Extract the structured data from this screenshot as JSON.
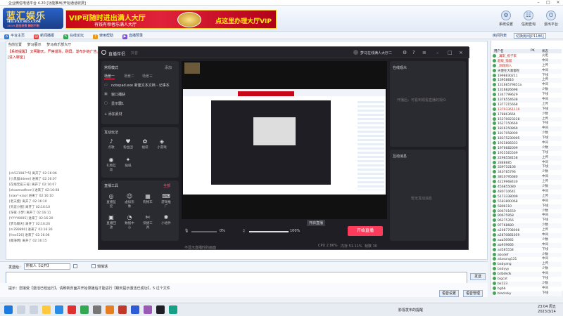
{
  "window": {
    "title": "企业微信电话平台 4.20 [功能推出/开始通话收费]"
  },
  "header": {
    "logo_main": "蓝汇娱乐",
    "logo_url": "HD.FXT365.COM",
    "logo_sub": "2019 超低资费 精彩不断",
    "banner_left": "VIP可随时进出满人大厅",
    "banner_left_sub": "有钱有帝者乐满人大厅",
    "banner_right": "点这里办理大厅VIP",
    "buttons": [
      {
        "label": "系统设置",
        "icon": "gear-icon"
      },
      {
        "label": "信用查询",
        "icon": "id-icon"
      },
      {
        "label": "退出平台",
        "icon": "exit-icon"
      }
    ]
  },
  "toolbar": {
    "items": [
      "平台主页",
      "新闻播报",
      "在线论坛",
      "使用帮助",
      "直播预录"
    ],
    "right_tabs": [
      "房间列表",
      "切换房间[P1186]"
    ]
  },
  "chat": {
    "tabs": [
      "当前位置",
      "梦马展示",
      "梦马商乐部大厅"
    ],
    "announcement": "【系统提醒】 文明聊天，严禁谩骂，刷屏，发布外链广告。违者永久封禁 ...",
    "welcome": "[进入聊室]",
    "log": [
      "[ch521987*5] 离开了 02:16:06",
      "[小黑猫ddeee] 进来了 02:16:07",
      "[在线无名三号] 离开了 02:16:07",
      "[zhaomadfrom] 进来了 02:16:08",
      "[xiao*-xiao] 进来了 02:16:10",
      "[老天使] 离开了 02:16:10",
      "[天涯小猪] 离开了 02:16:10",
      "[深夜 小梦] 离开了 02:16:11",
      "[YYYY0005] 进来了 02:16:20",
      "[梦马聊天] 离开了 02:16:26",
      "[m789890] 进来了 02:16:36",
      "[free526] 进来了 02:16:06",
      "[卿海明] 离开了 02:16:15"
    ]
  },
  "userlist": {
    "columns": [
      "用户名",
      "PK",
      "状态"
    ],
    "users": [
      {
        "name": "_翼影_橙子家",
        "status": "火炬"
      },
      {
        "name": "超级_猫猫",
        "status": "中间"
      },
      {
        "name": "_翔翔翔人",
        "status": "上传"
      },
      {
        "name": "天使在大家都在",
        "status": "中间"
      },
      {
        "name": "1998830211",
        "status": "下线"
      },
      {
        "name": "13958816",
        "status": "上传"
      },
      {
        "name": "13168579851a",
        "status": "中间"
      },
      {
        "name": "1316826698",
        "status": "少数"
      },
      {
        "name": "1347799629",
        "status": "下线"
      },
      {
        "name": "1376554638",
        "status": "中间"
      },
      {
        "name": "1377215668",
        "status": "上传"
      },
      {
        "name": "13793361119",
        "status": "下线"
      },
      {
        "name": "178863664",
        "status": "少数"
      },
      {
        "name": "15270023228",
        "status": "上传"
      },
      {
        "name": "1627150669",
        "status": "下线"
      },
      {
        "name": "1816150869",
        "status": "中间"
      },
      {
        "name": "1817058009",
        "status": "少数"
      },
      {
        "name": "18375230005",
        "status": "下线"
      },
      {
        "name": "1925808333",
        "status": "中间"
      },
      {
        "name": "1976682009",
        "status": "少数"
      },
      {
        "name": "1955565569",
        "status": "下线"
      },
      {
        "name": "2298558158",
        "status": "上传"
      },
      {
        "name": "2888885",
        "status": "中间"
      },
      {
        "name": "339710106",
        "status": "下线"
      },
      {
        "name": "340785796",
        "status": "少数"
      },
      {
        "name": "3810795680",
        "status": "中间"
      },
      {
        "name": "4229968430",
        "status": "上传"
      },
      {
        "name": "456855080",
        "status": "少数"
      },
      {
        "name": "480710641",
        "status": "中间"
      },
      {
        "name": "5173338009",
        "status": "上传"
      },
      {
        "name": "5583800068",
        "status": "中间"
      },
      {
        "name": "5806110",
        "status": "下线"
      },
      {
        "name": "806701659",
        "status": "少数"
      },
      {
        "name": "90675958",
        "status": "中间"
      },
      {
        "name": "96275356",
        "status": "下线"
      },
      {
        "name": "97768680",
        "status": "少数"
      },
      {
        "name": "a2087708008",
        "status": "上传"
      },
      {
        "name": "a2870881059",
        "status": "中间"
      },
      {
        "name": "aab56985",
        "status": "少数"
      },
      {
        "name": "ab939666",
        "status": "中间"
      },
      {
        "name": "ad585558",
        "status": "下线"
      },
      {
        "name": "abcdef",
        "status": "少数"
      },
      {
        "name": "aliasong131",
        "status": "中间"
      },
      {
        "name": "babyang",
        "status": "上传"
      },
      {
        "name": "babyyy",
        "status": "少数"
      },
      {
        "name": "bdbdkdk",
        "status": "中间"
      },
      {
        "name": "bigcat",
        "status": "下线"
      },
      {
        "name": "bk123",
        "status": "少数"
      },
      {
        "name": "bgbb",
        "status": "中间"
      },
      {
        "name": "blacksky",
        "status": "下线"
      }
    ]
  },
  "input": {
    "label": "发送给：",
    "select_value": "所有人【公开】",
    "checkbox_label": "悄悄话",
    "send_label": "发送",
    "tips": "提示：您接受【激活已经运行】，请刷新页面并开始录播后才能进行【聊天提示激活已成功】，5 过个文件",
    "btn_settings": "语音设置",
    "btn_manage": "语音管理"
  },
  "obs": {
    "app_name": "直播伴侣",
    "version": "抖音",
    "profile": "梦马在线满人大厅二",
    "scene_section": "常规模式",
    "scene_add": "添加",
    "scene_tabs": [
      "场景一",
      "场景二",
      "场景三"
    ],
    "sources": [
      "notepad.exe 新建文本文档 - 记事本",
      "窗口捕获",
      "显示器1"
    ],
    "add_source": "添加素材",
    "interact_title": "互动玩法",
    "interact_items": [
      "点歌",
      "粉丝团",
      "福袋",
      "小游戏",
      "礼物互动",
      "贴纸"
    ],
    "tools_title": "直播工具",
    "tools_link": "全部",
    "tools_items": [
      "直播监控",
      "虚拟形象",
      "购物车",
      "游戏推广",
      "直播回放",
      "数据中心",
      "快捷工具",
      "小组件"
    ],
    "room_title": "在线观众",
    "room_empty": "开播后，可看到观看直播的观众",
    "interact_msg_title": "互动消息",
    "interact_msg_empty": "暂无互动消息",
    "mic_pct": "0%",
    "speaker_pct": "100%",
    "go_live": "开始直播",
    "cpu": "CPU 2.86%",
    "mem": "内存 51.11%",
    "fps": "帧数 30",
    "screen_tip": "不显示直播时的画面",
    "tooltip": "开启直播"
  },
  "taskbar": {
    "running_label": "影视发布的提醒",
    "time": "23:04 周五",
    "date": "2023/3/24"
  }
}
